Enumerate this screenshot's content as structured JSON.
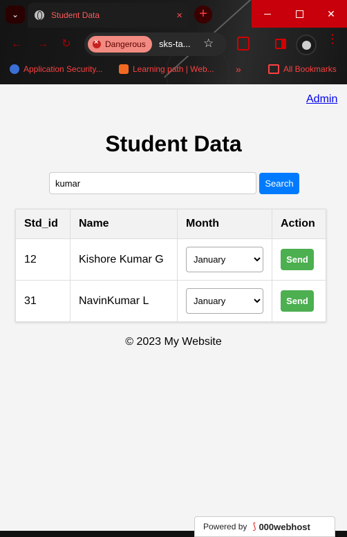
{
  "browser": {
    "tab_title": "Student Data",
    "tab_close": "×",
    "new_tab": "+",
    "security_chip": "Dangerous",
    "url": "sks-ta...",
    "bookmarks": [
      {
        "label": "Application Security..."
      },
      {
        "label": "Learning path | Web..."
      },
      {
        "label": "All Bookmarks"
      }
    ],
    "bookmarks_more": "»"
  },
  "page": {
    "admin_link": "Admin",
    "title": "Student Data",
    "search": {
      "value": "kumar",
      "button": "Search"
    },
    "table": {
      "headers": [
        "Std_id",
        "Name",
        "Month",
        "Action"
      ],
      "rows": [
        {
          "id": "12",
          "name": "Kishore Kumar G",
          "month": "January",
          "action": "Send"
        },
        {
          "id": "31",
          "name": "NavinKumar L",
          "month": "January",
          "action": "Send"
        }
      ]
    },
    "footer": "© 2023 My Website",
    "powered_by": {
      "prefix": "Powered by",
      "brand": "000webhost"
    }
  },
  "colors": {
    "primary_button": "#007bff",
    "send_button": "#4caf50",
    "link": "#0000ee",
    "chrome_accent": "#c8000b"
  }
}
